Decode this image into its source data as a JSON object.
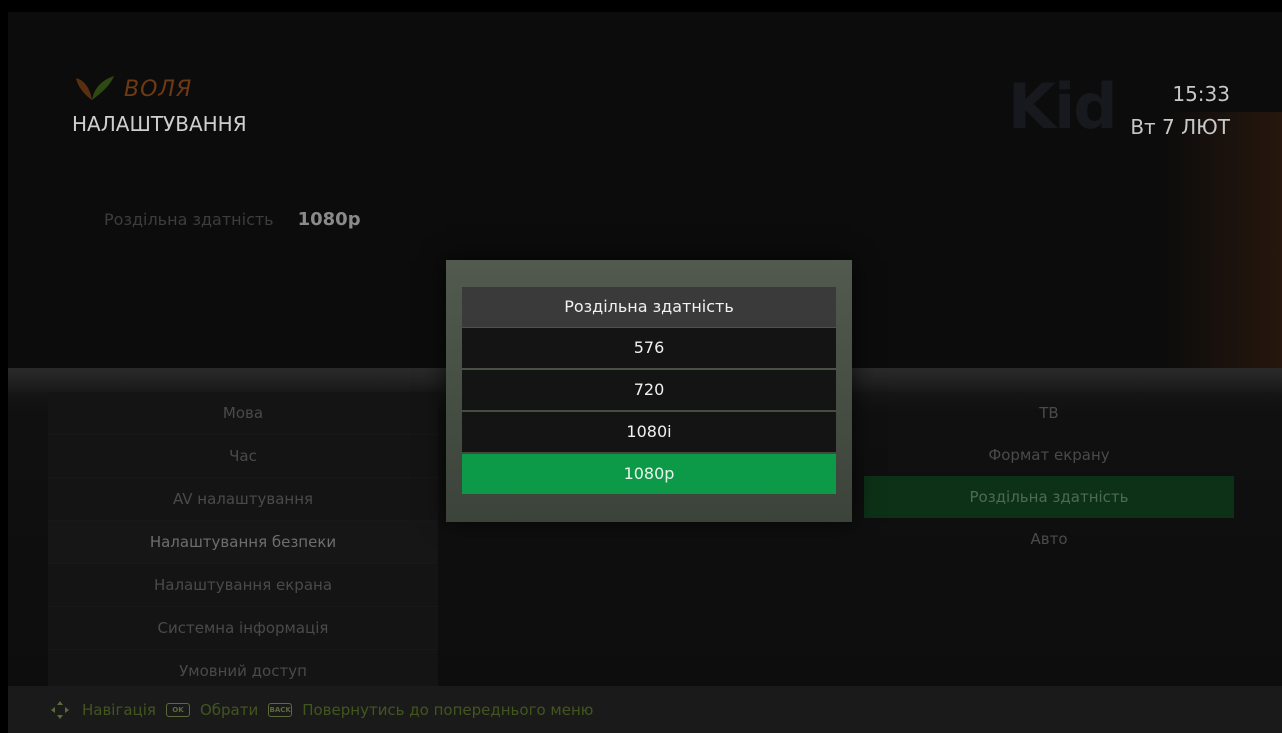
{
  "brand": {
    "name": "ВОЛЯ"
  },
  "header": {
    "title": "НАЛАШТУВАННЯ",
    "time": "15:33",
    "date": "Вт 7 ЛЮТ"
  },
  "background": {
    "channel_logo": "Kid"
  },
  "current_setting": {
    "label": "Роздільна здатність",
    "value": "1080p"
  },
  "left_menu": {
    "items": [
      {
        "label": "Мова"
      },
      {
        "label": "Час"
      },
      {
        "label": "AV налаштування"
      },
      {
        "label": "Налаштування безпеки"
      },
      {
        "label": "Налаштування екрана"
      },
      {
        "label": "Системна інформація"
      },
      {
        "label": "Умовний доступ"
      }
    ]
  },
  "right_menu": {
    "items": [
      {
        "label": "ТВ"
      },
      {
        "label": "Формат екрану"
      },
      {
        "label": "Роздільна здатність"
      },
      {
        "label": "Авто"
      }
    ]
  },
  "dialog": {
    "title": "Роздільна здатність",
    "options": [
      "576",
      "720",
      "1080i",
      "1080p"
    ],
    "selected": "1080p"
  },
  "footer": {
    "navigate_label": "Навігація",
    "ok_key": "OK",
    "select_label": "Обрати",
    "back_key": "BACK",
    "back_label": "Повернутись до попереднього меню"
  },
  "colors": {
    "accent": "#0c9a48",
    "brand": "#6d3a14",
    "selected_row": "#0d3117"
  },
  "icons": {
    "brand": "leaf-logo-icon",
    "navigate": "dpad-icon"
  }
}
